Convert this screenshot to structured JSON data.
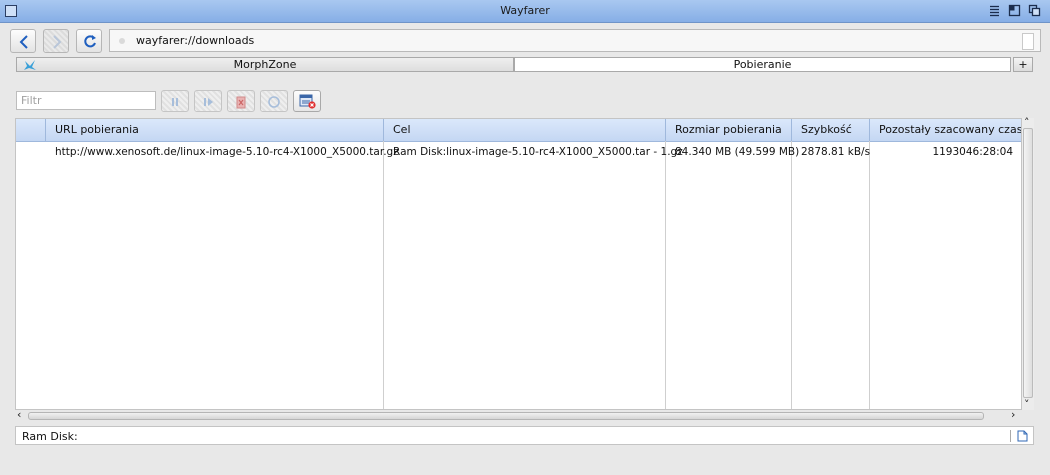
{
  "window": {
    "title": "Wayfarer"
  },
  "navigation": {
    "url": "wayfarer://downloads"
  },
  "tabs": [
    {
      "label": "MorphZone",
      "active": false
    },
    {
      "label": "Pobieranie",
      "active": true
    }
  ],
  "new_tab_label": "+",
  "toolbar": {
    "filter_placeholder": "Filtr"
  },
  "table": {
    "columns": [
      "URL pobierania",
      "Cel",
      "Rozmiar pobierania",
      "Szybkość",
      "Pozostały szacowany czas"
    ],
    "rows": [
      {
        "url": "http://www.xenosoft.de/linux-image-5.10-rc4-X1000_X5000.tar.gz",
        "target": "Ram Disk:linux-image-5.10-rc4-X1000_X5000.tar - 1.gz",
        "size": "84.340 MB (49.599 MB)",
        "speed": "2878.81 kB/s",
        "remaining": "1193046:28:04"
      }
    ]
  },
  "status": {
    "path": "Ram Disk:"
  },
  "colors": {
    "titlebar": "#86aee6",
    "header": "#c4d7f3",
    "nav_icon": "#1f5fbf"
  }
}
